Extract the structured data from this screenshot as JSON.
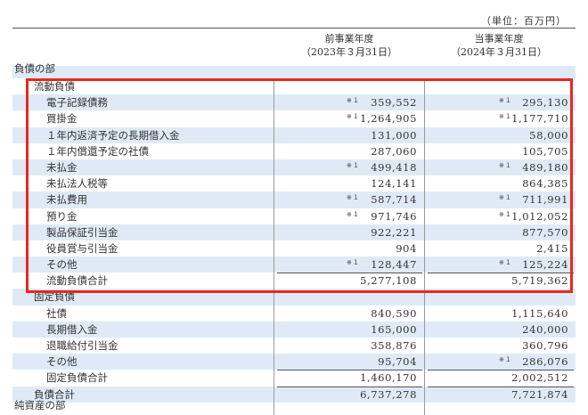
{
  "header": {
    "unit": "（単位：百万円）",
    "prev_year": "前事業年度",
    "prev_date": "（2023年３月31日）",
    "curr_year": "当事業年度",
    "curr_date": "（2024年３月31日）"
  },
  "rows": [
    {
      "label": "負債の部",
      "prev_mark": "",
      "prev": "",
      "curr_mark": "",
      "curr": ""
    },
    {
      "label": "流動負債",
      "prev_mark": "",
      "prev": "",
      "curr_mark": "",
      "curr": ""
    },
    {
      "label": "電子記録債務",
      "prev_mark": "※１",
      "prev": "359,552",
      "curr_mark": "※１",
      "curr": "295,130"
    },
    {
      "label": "買掛金",
      "prev_mark": "※１",
      "prev": "1,264,905",
      "curr_mark": "※１",
      "curr": "1,177,710"
    },
    {
      "label": "１年内返済予定の長期借入金",
      "prev_mark": "",
      "prev": "131,000",
      "curr_mark": "",
      "curr": "58,000"
    },
    {
      "label": "１年内償還予定の社債",
      "prev_mark": "",
      "prev": "287,060",
      "curr_mark": "",
      "curr": "105,705"
    },
    {
      "label": "未払金",
      "prev_mark": "※１",
      "prev": "499,418",
      "curr_mark": "※１",
      "curr": "489,180"
    },
    {
      "label": "未払法人税等",
      "prev_mark": "",
      "prev": "124,141",
      "curr_mark": "",
      "curr": "864,385"
    },
    {
      "label": "未払費用",
      "prev_mark": "※１",
      "prev": "587,714",
      "curr_mark": "※１",
      "curr": "711,991"
    },
    {
      "label": "預り金",
      "prev_mark": "※１",
      "prev": "971,746",
      "curr_mark": "※１",
      "curr": "1,012,052"
    },
    {
      "label": "製品保証引当金",
      "prev_mark": "",
      "prev": "922,221",
      "curr_mark": "",
      "curr": "877,570"
    },
    {
      "label": "役員賞与引当金",
      "prev_mark": "",
      "prev": "904",
      "curr_mark": "",
      "curr": "2,415"
    },
    {
      "label": "その他",
      "prev_mark": "※１",
      "prev": "128,447",
      "curr_mark": "※１",
      "curr": "125,224"
    },
    {
      "label": "流動負債合計",
      "prev_mark": "",
      "prev": "5,277,108",
      "curr_mark": "",
      "curr": "5,719,362"
    },
    {
      "label": "固定負債",
      "prev_mark": "",
      "prev": "",
      "curr_mark": "",
      "curr": ""
    },
    {
      "label": "社債",
      "prev_mark": "",
      "prev": "840,590",
      "curr_mark": "",
      "curr": "1,115,640"
    },
    {
      "label": "長期借入金",
      "prev_mark": "",
      "prev": "165,000",
      "curr_mark": "",
      "curr": "240,000"
    },
    {
      "label": "退職給付引当金",
      "prev_mark": "",
      "prev": "358,876",
      "curr_mark": "",
      "curr": "360,796"
    },
    {
      "label": "その他",
      "prev_mark": "",
      "prev": "95,704",
      "curr_mark": "※１",
      "curr": "286,076"
    },
    {
      "label": "固定負債合計",
      "prev_mark": "",
      "prev": "1,460,170",
      "curr_mark": "",
      "curr": "2,002,512"
    },
    {
      "label": "負債合計",
      "prev_mark": "",
      "prev": "6,737,278",
      "curr_mark": "",
      "curr": "7,721,874"
    },
    {
      "label": "純資産の部",
      "prev_mark": "",
      "prev": "",
      "curr_mark": "",
      "curr": ""
    }
  ]
}
